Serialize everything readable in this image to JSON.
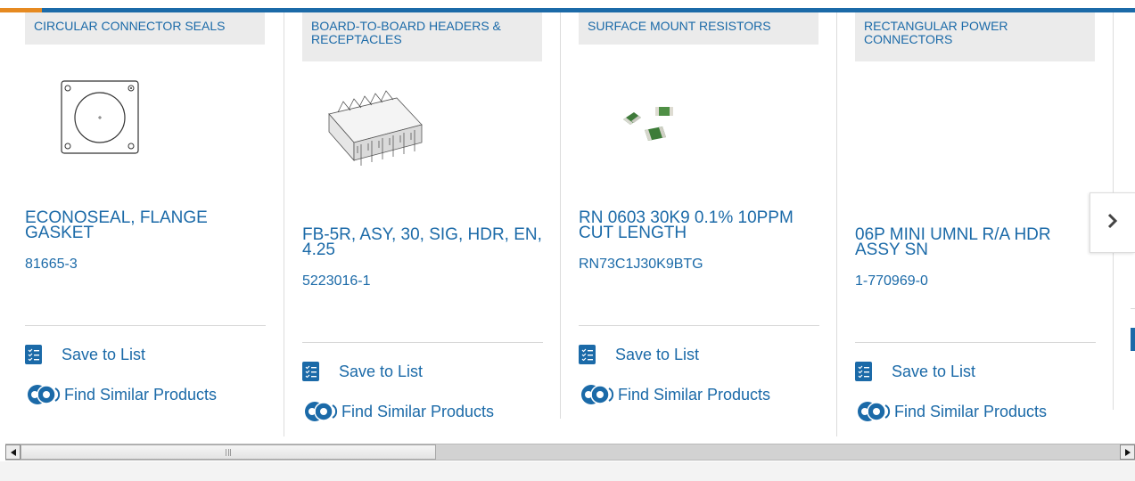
{
  "colors": {
    "brand_blue": "#1b6aa8",
    "accent_orange": "#e68a21",
    "tag_background": "#ebebeb"
  },
  "actions": {
    "save_label": "Save to List",
    "similar_label": "Find Similar Products"
  },
  "cards": [
    {
      "category": "CIRCULAR CONNECTOR SEALS",
      "title": "ECONOSEAL, FLANGE GASKET",
      "part_number": "81665-3",
      "image_icon": "flange-gasket-image"
    },
    {
      "category": "BOARD-TO-BOARD HEADERS & RECEPTACLES",
      "title": "FB-5R, ASY, 30, SIG, HDR, EN, 4.25",
      "part_number": "5223016-1",
      "image_icon": "header-connector-image"
    },
    {
      "category": "SURFACE MOUNT RESISTORS",
      "title": "RN 0603 30K9 0.1% 10PPM CUT LENGTH",
      "part_number": "RN73C1J30K9BTG",
      "image_icon": "chip-resistors-image"
    },
    {
      "category": "RECTANGULAR POWER CONNECTORS",
      "title": "06P MINI UMNL R/A HDR ASSY SN",
      "part_number": "1-770969-0",
      "image_icon": ""
    }
  ],
  "navigation": {
    "next_icon": "chevron-right-icon"
  },
  "scrollbar": {
    "left_icon": "arrow-left-icon",
    "right_icon": "arrow-right-icon",
    "position_fraction": 0.0
  }
}
